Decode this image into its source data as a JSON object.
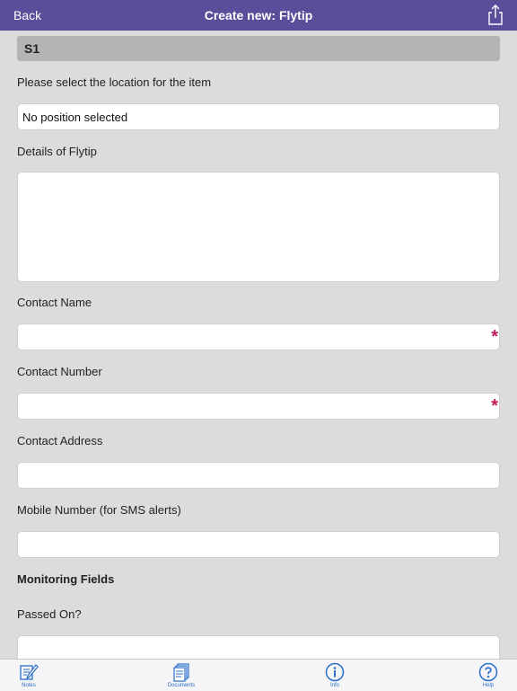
{
  "navbar": {
    "back_label": "Back",
    "title": "Create new: Flytip",
    "share_icon": "share-icon"
  },
  "form": {
    "section_title": "S1",
    "location_label": "Please select the location for the item",
    "location_value": "No position selected",
    "details_label": "Details of Flytip",
    "details_value": "",
    "contact_name_label": "Contact Name",
    "contact_name_value": "",
    "contact_number_label": "Contact Number",
    "contact_number_value": "",
    "contact_address_label": "Contact Address",
    "contact_address_value": "",
    "mobile_label": "Mobile Number (for SMS alerts)",
    "mobile_value": "",
    "monitoring_heading": "Monitoring Fields",
    "passed_on_label": "Passed On?",
    "passed_on_value": "",
    "required_marker": "*"
  },
  "tabbar": {
    "items": [
      {
        "label": "Notes",
        "icon": "notes-icon"
      },
      {
        "label": "Documents",
        "icon": "documents-icon"
      },
      {
        "label": "Info",
        "icon": "info-icon"
      },
      {
        "label": "Help",
        "icon": "help-icon"
      }
    ]
  },
  "colors": {
    "navbar": "#5c4d9b",
    "background": "#dcdcdc",
    "required": "#c0185c",
    "tab_accent": "#2a6fc9"
  }
}
